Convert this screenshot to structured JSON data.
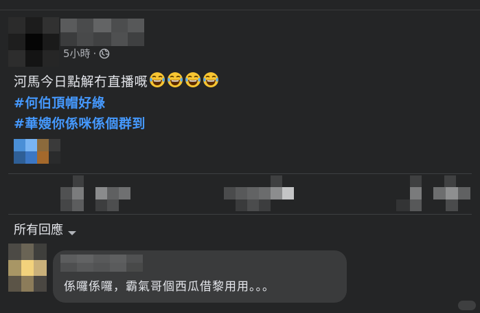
{
  "post": {
    "timestamp": "5小時",
    "separator": "·",
    "privacy_icon": "globe-icon",
    "line1": "河馬今日點解冇直播嘅",
    "emoji": "face-with-tears-of-joy-emoji",
    "emoji_count": 4,
    "hashtag1": "#何伯頂帽好綠",
    "hashtag2": "#華嫂你係咪係個群到"
  },
  "comments": {
    "sort_label": "所有回應",
    "sort_icon": "caret-down-icon",
    "items": [
      {
        "text": "係囉係囉，霸氣哥個西瓜借黎用用。。。"
      }
    ]
  },
  "colors": {
    "background": "#242526",
    "text": "#e4e6eb",
    "secondary_text": "#b0b3b8",
    "hashtag": "#4599ff",
    "bubble": "#3a3b3c"
  }
}
